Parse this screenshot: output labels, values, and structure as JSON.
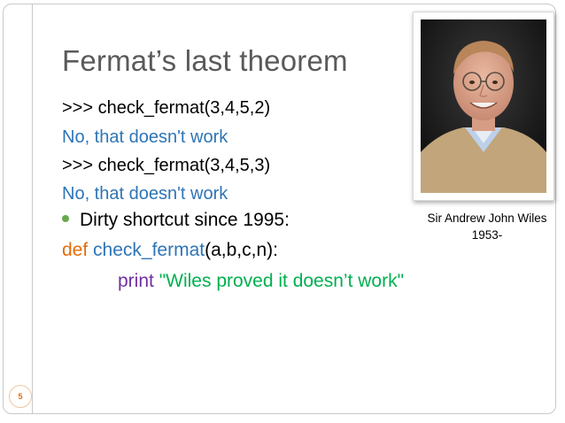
{
  "slide": {
    "title": "Fermat’s last theorem",
    "lines": {
      "l1": ">>> check_fermat(3,4,5,2)",
      "l2": "No, that doesn't work",
      "l3": ">>> check_fermat(3,4,5,3)",
      "l4": "No, that doesn't work",
      "l5": "Dirty shortcut since 1995:",
      "l6_def": "def",
      "l6_name": "check_fermat",
      "l6_args": "(a,b,c,n):",
      "l7_print": "print",
      "l7_string": "\"Wiles proved it doesn’t work\""
    },
    "photo": {
      "caption_name": "Sir Andrew John Wiles",
      "caption_year": "1953-"
    },
    "slide_number": "5",
    "colors": {
      "title": "#5a5a5a",
      "code_output": "#2e75b6",
      "keyword_def": "#e46c0a",
      "keyword_print": "#7030a0",
      "string": "#00b050",
      "bullet": "#6aa84f"
    }
  }
}
